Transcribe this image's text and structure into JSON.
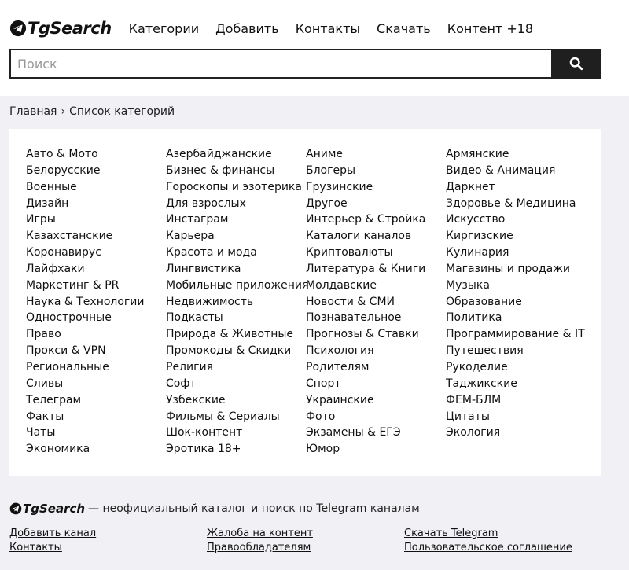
{
  "brand": {
    "name": "TgSearch"
  },
  "nav": [
    "Категории",
    "Добавить",
    "Контакты",
    "Скачать",
    "Контент +18"
  ],
  "search": {
    "placeholder": "Поиск",
    "value": "",
    "button_icon": "search-icon"
  },
  "breadcrumb": {
    "home": "Главная",
    "separator": "›",
    "current": "Список категорий"
  },
  "categories": [
    [
      "Авто & Мото",
      "Белорусские",
      "Военные",
      "Дизайн",
      "Игры",
      "Казахстанские",
      "Коронавирус",
      "Лайфхаки",
      "Маркетинг & PR",
      "Наука & Технологии",
      "Однострочные",
      "Право",
      "Прокси & VPN",
      "Региональные",
      "Сливы",
      "Телеграм",
      "Факты",
      "Чаты",
      "Экономика"
    ],
    [
      "Азербайджанские",
      "Бизнес & финансы",
      "Гороскопы и эзотерика",
      "Для взрослых",
      "Инстаграм",
      "Карьера",
      "Красота и мода",
      "Лингвистика",
      "Мобильные приложения",
      "Недвижимость",
      "Подкасты",
      "Природа & Животные",
      "Промокоды & Скидки",
      "Религия",
      "Софт",
      "Узбекские",
      "Фильмы & Сериалы",
      "Шок-контент",
      "Эротика 18+"
    ],
    [
      "Аниме",
      "Блогеры",
      "Грузинские",
      "Другое",
      "Интерьер & Стройка",
      "Каталоги каналов",
      "Криптовалюты",
      "Литература & Книги",
      "Молдавские",
      "Новости & СМИ",
      "Познавательное",
      "Прогнозы & Ставки",
      "Психология",
      "Родителям",
      "Спорт",
      "Украинские",
      "Фото",
      "Экзамены & ЕГЭ",
      "Юмор"
    ],
    [
      "Армянские",
      "Видео & Анимация",
      "Даркнет",
      "Здоровье & Медицина",
      "Искусство",
      "Киргизские",
      "Кулинария",
      "Магазины и продажи",
      "Музыка",
      "Образование",
      "Политика",
      "Программирование & IT",
      "Путешествия",
      "Рукоделие",
      "Таджикские",
      "ФЕМ-БЛМ",
      "Цитаты",
      "Экология"
    ]
  ],
  "footer": {
    "brand": "TgSearch",
    "tagline": "— неофициальный каталог и поиск по Telegram каналам",
    "links": [
      [
        "Добавить канал",
        "Контакты"
      ],
      [
        "Жалоба на контент",
        "Правообладателям"
      ],
      [
        "Скачать Telegram",
        "Пользовательское соглашение"
      ]
    ]
  },
  "colors": {
    "background": "#f1f1f5",
    "panel": "#ffffff",
    "search_button": "#1f1f1f",
    "text": "#111111"
  }
}
